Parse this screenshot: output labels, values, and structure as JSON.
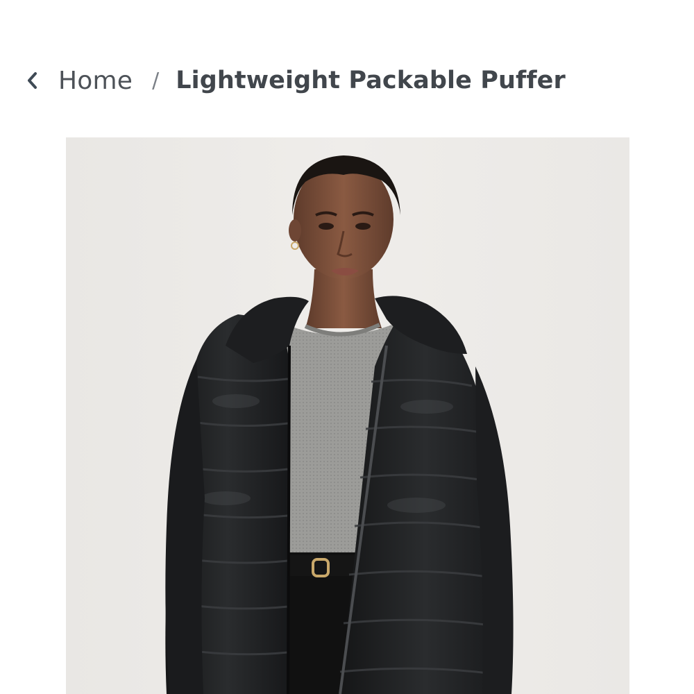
{
  "breadcrumb": {
    "back_icon": "chevron-left-icon",
    "home_label": "Home",
    "separator": "/",
    "current_label": "Lightweight Packable Puffer"
  },
  "product": {
    "image": {
      "subject": "model-wearing-black-puffer-jacket",
      "colors": {
        "background": "#edebe8",
        "jacket": "#1b1c1d",
        "sweater": "#9b9b98",
        "skin": "#7a4f3a",
        "hair": "#1a1512",
        "pants": "#111111",
        "buckle": "#c9a86a"
      }
    }
  }
}
